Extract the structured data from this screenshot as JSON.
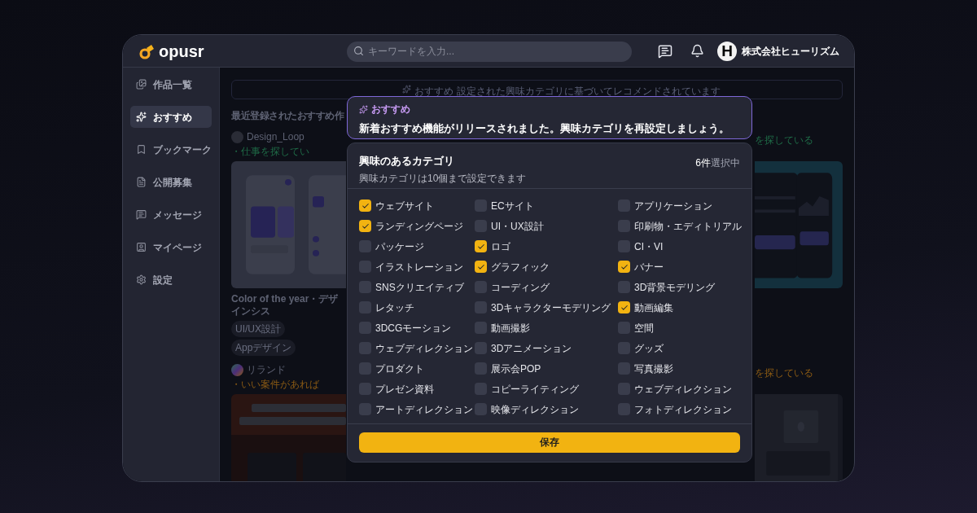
{
  "header": {
    "logo": "opusr",
    "search": {
      "placeholder": "キーワードを入力..."
    },
    "account": {
      "avatar": "H",
      "name": "株式会社ヒューリズム"
    }
  },
  "sidebar": {
    "items": [
      {
        "label": "作品一覧",
        "selected": false
      },
      {
        "label": "おすすめ",
        "selected": true
      },
      {
        "label": "ブックマーク",
        "selected": false
      },
      {
        "label": "公開募集",
        "selected": false
      },
      {
        "label": "メッセージ",
        "selected": false
      },
      {
        "label": "マイページ",
        "selected": false
      },
      {
        "label": "設定",
        "selected": false
      }
    ]
  },
  "main": {
    "banner": {
      "label": "おすすめ",
      "text": "設定された興味カテゴリに基づいてレコメンドされています"
    },
    "heading": "最近登録されたおすすめ作",
    "posts": [
      {
        "author": "Design_Loop",
        "status": "・仕事を探してい",
        "status_tail": "を探している",
        "color": "#1f6b47",
        "title": "Color of the year・デザインシス",
        "tags": [
          "UI/UX設計",
          "Appデザイン"
        ]
      },
      {
        "author": "リランド",
        "status": "・いい案件があれば",
        "status_tail": "を探している",
        "color": "#8a5a14"
      }
    ]
  },
  "toast": {
    "label": "おすすめ",
    "message": "新着おすすめ機能がリリースされました。興味カテゴリを再設定しましょう。"
  },
  "dialog": {
    "title": "興味のあるカテゴリ",
    "count": "6件",
    "count_suffix": "選択中",
    "note": "興味カテゴリは10個まで設定できます",
    "categories": [
      {
        "label": "ウェブサイト",
        "checked": true
      },
      {
        "label": "ECサイト",
        "checked": false
      },
      {
        "label": "アプリケーション",
        "checked": false
      },
      {
        "label": "ランディングページ",
        "checked": true
      },
      {
        "label": "UI・UX設計",
        "checked": false
      },
      {
        "label": "印刷物・エディトリアル",
        "checked": false
      },
      {
        "label": "パッケージ",
        "checked": false
      },
      {
        "label": "ロゴ",
        "checked": true
      },
      {
        "label": "CI・VI",
        "checked": false
      },
      {
        "label": "イラストレーション",
        "checked": false
      },
      {
        "label": "グラフィック",
        "checked": true
      },
      {
        "label": "バナー",
        "checked": true
      },
      {
        "label": "SNSクリエイティブ",
        "checked": false
      },
      {
        "label": "コーディング",
        "checked": false
      },
      {
        "label": "3D背景モデリング",
        "checked": false
      },
      {
        "label": "レタッチ",
        "checked": false
      },
      {
        "label": "3Dキャラクターモデリング",
        "checked": false
      },
      {
        "label": "動画編集",
        "checked": true
      },
      {
        "label": "3DCGモーション",
        "checked": false
      },
      {
        "label": "動画撮影",
        "checked": false
      },
      {
        "label": "空間",
        "checked": false
      },
      {
        "label": "ウェブディレクション",
        "checked": false
      },
      {
        "label": "3Dアニメーション",
        "checked": false
      },
      {
        "label": "グッズ",
        "checked": false
      },
      {
        "label": "プロダクト",
        "checked": false
      },
      {
        "label": "展示会POP",
        "checked": false
      },
      {
        "label": "写真撮影",
        "checked": false
      },
      {
        "label": "プレゼン資料",
        "checked": false
      },
      {
        "label": "コピーライティング",
        "checked": false
      },
      {
        "label": "ウェブディレクション",
        "checked": false
      },
      {
        "label": "アートディレクション",
        "checked": false
      },
      {
        "label": "映像ディレクション",
        "checked": false
      },
      {
        "label": "フォトディレクション",
        "checked": false
      }
    ],
    "save_button": "保存"
  }
}
